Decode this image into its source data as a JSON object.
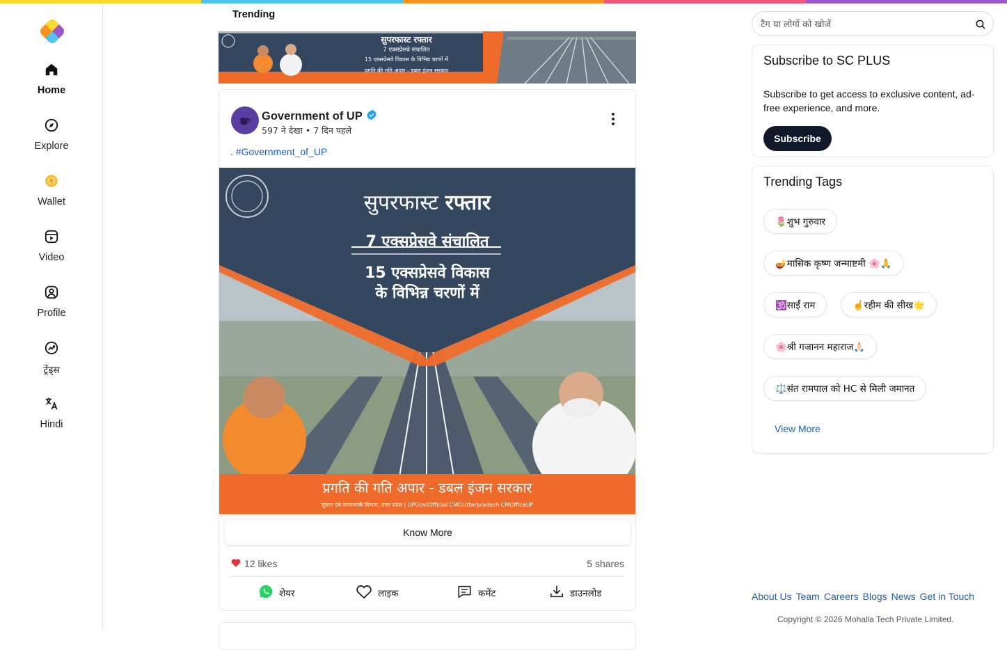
{
  "colors": {
    "bar": [
      "#fbd92f",
      "#4ec4ee",
      "#f7931e",
      "#f2557a",
      "#9b59c7"
    ],
    "accent": "#1f5fa8",
    "subscribe_bg": "#111827"
  },
  "sidebar": {
    "items": [
      {
        "label": "Home",
        "icon": "home-icon"
      },
      {
        "label": "Explore",
        "icon": "compass-icon"
      },
      {
        "label": "Wallet",
        "icon": "coin-icon"
      },
      {
        "label": "Video",
        "icon": "video-icon"
      },
      {
        "label": "Profile",
        "icon": "profile-icon"
      },
      {
        "label": "ट्रेंड्स",
        "icon": "trends-icon"
      },
      {
        "label": "Hindi",
        "icon": "translate-icon"
      }
    ]
  },
  "feed": {
    "section_title": "Trending",
    "post": {
      "author": "Government of UP",
      "views": "597 ने देखा",
      "time": "7 दिन पहले",
      "caption_prefix": ". ",
      "hashtag": "#Government_of_UP",
      "image": {
        "headline_1": "सुपरफास्ट",
        "headline_2": "रफ्तार",
        "line_1": "7 एक्सप्रेसवे संचालित",
        "line_2": "15 एक्सप्रेसवे विकास",
        "line_3": "के विभिन्न चरणों में",
        "footer": "प्रगति की गति अपार - डबल इंजन सरकार",
        "sub_footer": "सूचना एवं जनसम्पर्क विभाग, उत्तर प्रदेश  |  UPGovtOfficial  CMOUttarpradesh  CMOfficeUP"
      },
      "banner": {
        "headline": "सुपरफास्ट रफ्तार",
        "line_1": "7 एक्सप्रेसवे संचालित",
        "line_2": "15 एक्सप्रेसवे विकास के विभिन्न चरणों में",
        "line_3": "प्रगति की गति अपार - डबल इंजन सरकार"
      },
      "know_more": "Know More",
      "likes": "12 likes",
      "shares": "5 shares",
      "actions": {
        "share": "शेयर",
        "like": "लाइक",
        "comment": "कमेंट",
        "download": "डाउनलोड"
      }
    }
  },
  "search": {
    "placeholder": "टैग या लोगों को खोजें"
  },
  "subscribe": {
    "title": "Subscribe to SC PLUS",
    "text": "Subscribe to get access to exclusive content, ad-free experience, and more.",
    "button": "Subscribe"
  },
  "trending_tags": {
    "title": "Trending Tags",
    "tags": [
      "🌷शुभ गुरुवार",
      "🪔मासिक कृष्ण जन्माष्टमी 🌸🙏",
      "🕉️साईं राम",
      "☝️रहीम की सीख🌟",
      "🌸श्री गजानन महाराज🙏🏻",
      "⚖️संत रामपाल को HC से मिली जमानत"
    ],
    "view_more": "View More"
  },
  "footer": {
    "links": [
      "About Us",
      "Team",
      "Careers",
      "Blogs",
      "News",
      "Get in Touch"
    ],
    "copyright": "Copyright © 2026 Mohalla Tech Private Limited."
  }
}
